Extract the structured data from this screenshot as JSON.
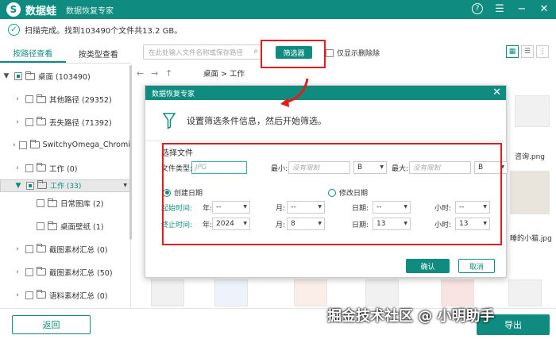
{
  "app": {
    "name": "数据蛙",
    "subtitle": "数据恢复专家",
    "logo_letter": "S",
    "accent": "#0f8c7f"
  },
  "status": {
    "text": "扫描完成。找到103490个文件共13.2 GB。"
  },
  "left_tabs": [
    "按路径查看",
    "按类型查看"
  ],
  "tree": [
    {
      "label": "桌面 (103490)",
      "arrow": "▼"
    },
    {
      "label": "其他路径 (29352)",
      "arrow": "›"
    },
    {
      "label": "丢失路径 (71392)",
      "arrow": "›"
    },
    {
      "label": "SwitchyOmega_Chromium",
      "arrow": "›"
    },
    {
      "label": "工作 (0)",
      "arrow": "›"
    },
    {
      "label": "工作 (33)",
      "arrow": "▼"
    },
    {
      "label": "日常图库 (2)",
      "arrow": ""
    },
    {
      "label": "桌面壁纸 (1)",
      "arrow": ""
    },
    {
      "label": "截图素材汇总 (0)",
      "arrow": "›"
    },
    {
      "label": "截图素材汇总 (50)",
      "arrow": "›"
    },
    {
      "label": "语料素材汇总 (0)",
      "arrow": "›"
    }
  ],
  "search": {
    "placeholder": "在此处输入文件名称或保存路径"
  },
  "toolbar": {
    "filter_label": "筛选器",
    "only_deleted_label": "仅显示删除除"
  },
  "nav": {
    "breadcrumb": "桌面 > 工作"
  },
  "background": {
    "file1": "咨询.png",
    "file2": "小猫.jpg",
    "file2_prefix": "睡的"
  },
  "dialog": {
    "title": "数据恢复专家",
    "heading": "设置筛选条件信息，然后开始筛选。",
    "section": "选择文件",
    "file_type_label": "文件类型:",
    "file_type_placeholder": "JPG",
    "min_label": "最小:",
    "min_placeholder": "没有限制",
    "min_unit": "B",
    "max_label": "最大:",
    "max_placeholder": "没有限制",
    "max_unit": "B",
    "date_created": "创建日期",
    "date_modified": "修改日期",
    "start_label": "起始时间:",
    "end_label": "终止时间:",
    "year_label": "年:",
    "month_label": "月:",
    "day_label": "日期:",
    "hour_label": "小时:",
    "start": {
      "year": "--",
      "month": "--",
      "day": "--",
      "hour": "--"
    },
    "end": {
      "year": "2024",
      "month": "8",
      "day": "13",
      "hour": "13"
    },
    "ok": "确认",
    "cancel": "取消"
  },
  "bottom": {
    "back": "返回",
    "next": "导出"
  },
  "watermark": "掘金技术社区 @ 小明助手"
}
